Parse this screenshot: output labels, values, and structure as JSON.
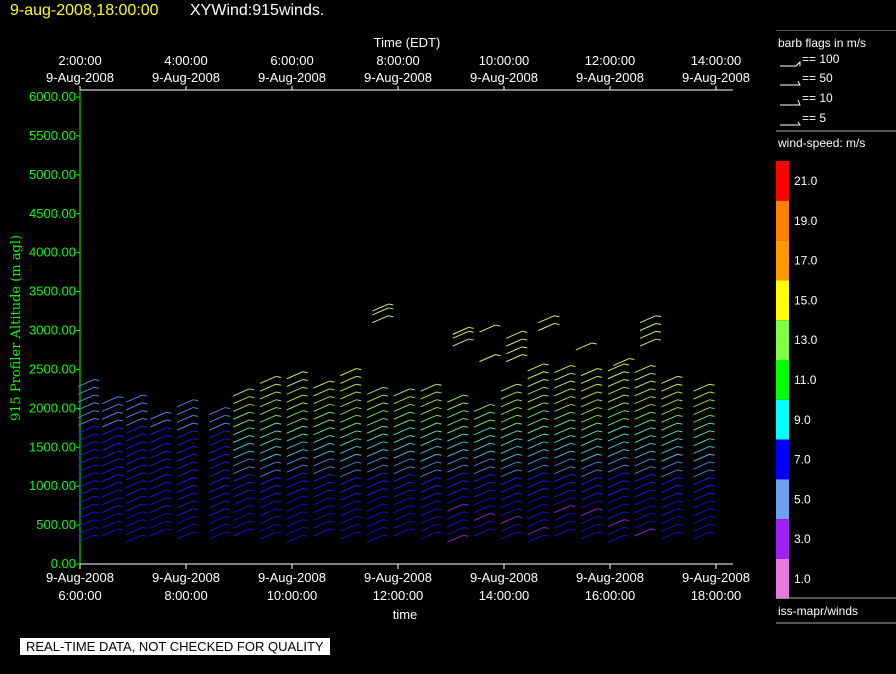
{
  "header": {
    "date_time": "9-aug-2008,18:00:00",
    "product": "XYWind:915winds."
  },
  "quality_note": "REAL-TIME DATA, NOT CHECKED FOR QUALITY",
  "legend": {
    "barb_title": "barb flags in m/s",
    "barbs": [
      "== 100",
      "== 50",
      "== 10",
      "== 5"
    ],
    "speed_title": "wind-speed: m/s",
    "speed_labels": [
      "21.0",
      "19.0",
      "17.0",
      "15.0",
      "13.0",
      "11.0",
      "9.0",
      "7.0",
      "5.0",
      "3.0",
      "1.0"
    ],
    "speed_colors": [
      "#ff0000",
      "#ff8000",
      "#ff9a00",
      "#ffff00",
      "#80ff40",
      "#00ff00",
      "#00ffff",
      "#0000ff",
      "#6ea0f0",
      "#a020f0",
      "#e878e0"
    ],
    "source": "iss-mapr/winds"
  },
  "chart_data": {
    "type": "scatter",
    "title": "",
    "top_axis_title": "Time (EDT)",
    "top_axis_ticks": [
      [
        "2:00:00",
        "9-Aug-2008"
      ],
      [
        "4:00:00",
        "9-Aug-2008"
      ],
      [
        "6:00:00",
        "9-Aug-2008"
      ],
      [
        "8:00:00",
        "9-Aug-2008"
      ],
      [
        "10:00:00",
        "9-Aug-2008"
      ],
      [
        "12:00:00",
        "9-Aug-2008"
      ],
      [
        "14:00:00",
        "9-Aug-2008"
      ]
    ],
    "xlabel": "time",
    "x_ticks": [
      [
        "9-Aug-2008",
        "6:00:00"
      ],
      [
        "9-Aug-2008",
        "8:00:00"
      ],
      [
        "9-Aug-2008",
        "10:00:00"
      ],
      [
        "9-Aug-2008",
        "12:00:00"
      ],
      [
        "9-Aug-2008",
        "14:00:00"
      ],
      [
        "9-Aug-2008",
        "16:00:00"
      ],
      [
        "9-Aug-2008",
        "18:00:00"
      ]
    ],
    "xlim": [
      6.0,
      18.2
    ],
    "ylabel": "915 Profiler Altitude (m agl)",
    "y_ticks": [
      "0.00",
      "500.00",
      "1000.00",
      "1500.00",
      "2000.00",
      "2500.00",
      "3000.00",
      "3500.00",
      "4000.00",
      "4500.00",
      "5000.00",
      "5500.00",
      "6000.00"
    ],
    "ylim": [
      0,
      6000
    ],
    "series": [
      {
        "time": 6.0,
        "top": 2350
      },
      {
        "time": 6.45,
        "top": 2100
      },
      {
        "time": 6.9,
        "top": 2100
      },
      {
        "time": 7.35,
        "top": 1900
      },
      {
        "time": 7.85,
        "top": 2100
      },
      {
        "time": 8.45,
        "top": 2000
      },
      {
        "time": 8.9,
        "top": 2250
      },
      {
        "time": 9.4,
        "top": 2320
      },
      {
        "time": 9.9,
        "top": 2380
      },
      {
        "time": 10.4,
        "top": 2350
      },
      {
        "time": 10.9,
        "top": 2500
      },
      {
        "time": 11.4,
        "top": 2230
      },
      {
        "time": 11.9,
        "top": 2230
      },
      {
        "time": 12.4,
        "top": 2300
      },
      {
        "time": 12.9,
        "top": 2150
      },
      {
        "time": 13.4,
        "top": 2000
      },
      {
        "time": 13.9,
        "top": 2300
      },
      {
        "time": 14.4,
        "top": 2530
      },
      {
        "time": 14.9,
        "top": 2480
      },
      {
        "time": 15.4,
        "top": 2430
      },
      {
        "time": 15.9,
        "top": 2480
      },
      {
        "time": 16.4,
        "top": 2480
      },
      {
        "time": 16.9,
        "top": 2380
      },
      {
        "time": 17.5,
        "top": 2300
      }
    ],
    "isolated_barbs": [
      {
        "time": 11.5,
        "heights": [
          3100,
          3200,
          3250
        ]
      },
      {
        "time": 13.0,
        "heights": [
          2800,
          2900,
          2950
        ]
      },
      {
        "time": 13.5,
        "heights": [
          2600,
          2980
        ]
      },
      {
        "time": 14.0,
        "heights": [
          2600,
          2700,
          2800,
          2900
        ]
      },
      {
        "time": 14.6,
        "heights": [
          3000,
          3100
        ]
      },
      {
        "time": 15.3,
        "heights": [
          2750
        ]
      },
      {
        "time": 16.0,
        "heights": [
          2550
        ]
      },
      {
        "time": 16.5,
        "heights": [
          2800,
          2900,
          3000,
          3100
        ]
      }
    ]
  }
}
